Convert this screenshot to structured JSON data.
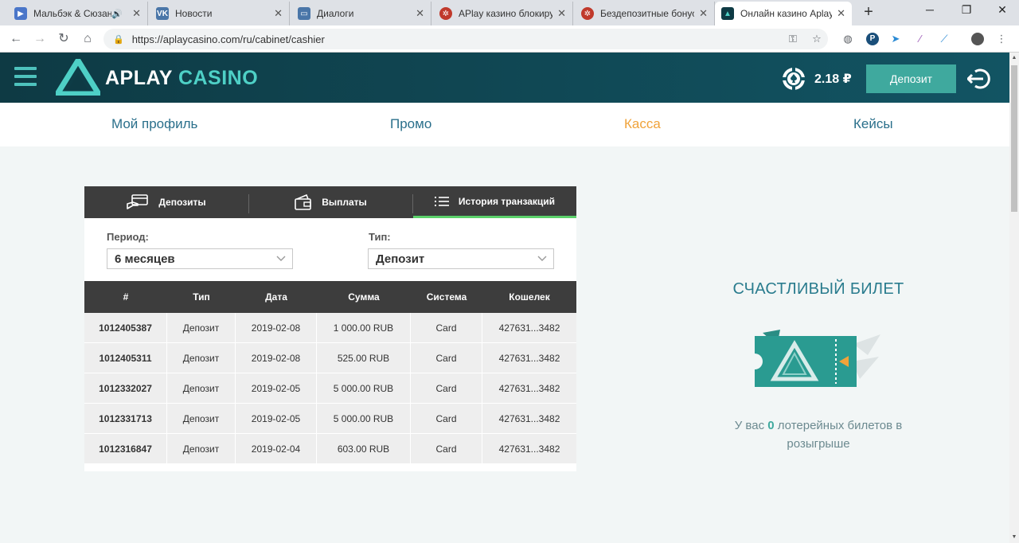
{
  "browser": {
    "tabs": [
      {
        "title": "Мальбэк & Сюзан",
        "favicon": "video-icon",
        "color": "#4a76c9",
        "audio": true
      },
      {
        "title": "Новости",
        "favicon": "vk-icon",
        "color": "#4a76a8"
      },
      {
        "title": "Диалоги",
        "favicon": "chat-icon",
        "color": "#4a76a8"
      },
      {
        "title": "APlay казино блокиру",
        "favicon": "chip-icon",
        "color": "#c0392b"
      },
      {
        "title": "Бездепозитные бонус",
        "favicon": "chip-icon",
        "color": "#c0392b"
      },
      {
        "title": "Онлайн казино Aplay",
        "favicon": "aplay-icon",
        "color": "#0e3a44",
        "active": true
      }
    ],
    "address": "https://aplaycasino.com/ru/cabinet/cashier"
  },
  "header": {
    "logo_word1": "APLAY",
    "logo_word2": "CASINO",
    "balance": "2.18 ₽",
    "deposit_label": "Депозит"
  },
  "nav": {
    "items": [
      {
        "label": "Мой профиль"
      },
      {
        "label": "Промо"
      },
      {
        "label": "Касса",
        "active": true
      },
      {
        "label": "Кейсы"
      }
    ]
  },
  "cashier": {
    "tabs": [
      {
        "label": "Депозиты",
        "icon": "card-hand-icon"
      },
      {
        "label": "Выплаты",
        "icon": "wallet-icon"
      },
      {
        "label": "История транзакций",
        "icon": "list-icon",
        "active": true
      }
    ],
    "period_label": "Период:",
    "period_value": "6 месяцев",
    "type_label": "Тип:",
    "type_value": "Депозит",
    "table": {
      "headers": [
        "#",
        "Тип",
        "Дата",
        "Сумма",
        "Система",
        "Кошелек"
      ],
      "rows": [
        [
          "1012405387",
          "Депозит",
          "2019-02-08",
          "1 000.00 RUB",
          "Card",
          "427631...3482"
        ],
        [
          "1012405311",
          "Депозит",
          "2019-02-08",
          "525.00 RUB",
          "Card",
          "427631...3482"
        ],
        [
          "1012332027",
          "Депозит",
          "2019-02-05",
          "5 000.00 RUB",
          "Card",
          "427631...3482"
        ],
        [
          "1012331713",
          "Депозит",
          "2019-02-05",
          "5 000.00 RUB",
          "Card",
          "427631...3482"
        ],
        [
          "1012316847",
          "Депозит",
          "2019-02-04",
          "603.00 RUB",
          "Card",
          "427631...3482"
        ]
      ]
    }
  },
  "lottery": {
    "title": "СЧАСТЛИВЫЙ БИЛЕТ",
    "text_before": "У вас",
    "count": "0",
    "text_after": "лотерейных билетов в розыгрыше"
  },
  "colors": {
    "header_bg": "#0e3a44",
    "accent_teal": "#3fa99e",
    "nav_active": "#f0a33a",
    "dark_bar": "#3d3d3d",
    "tab_underline": "#5bd16a"
  }
}
